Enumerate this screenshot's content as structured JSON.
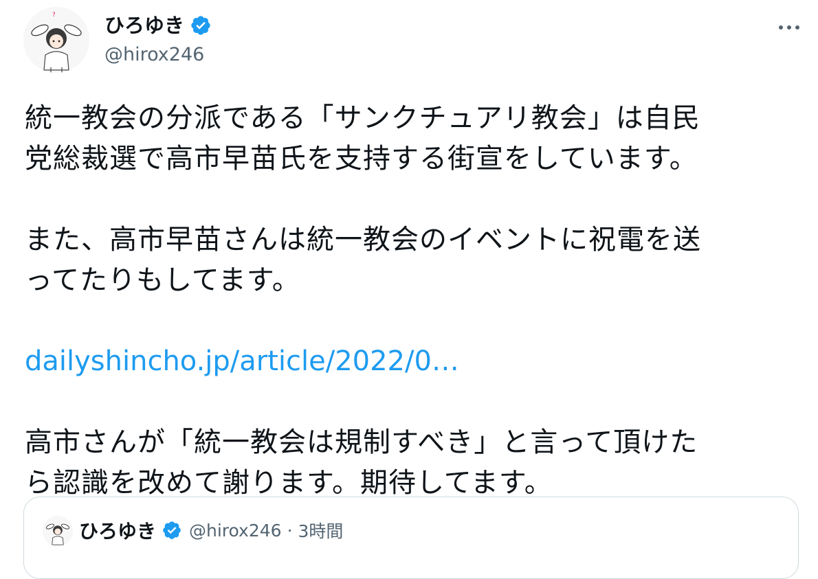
{
  "author": {
    "display_name": "ひろゆき",
    "handle": "@hirox246",
    "avatar_icon": "bunny-girl-avatar-icon",
    "verified_icon": "verified-badge-icon"
  },
  "menu": {
    "more_icon": "more-options-icon"
  },
  "tweet": {
    "para1_line1": "統一教会の分派である「サンクチュアリ教会」は自民",
    "para1_line2": "党総裁選で高市早苗氏を支持する街宣をしています。",
    "para2_line1": "また、高市早苗さんは統一教会のイベントに祝電を送",
    "para2_line2": "ってたりもしてます。",
    "link": "dailyshincho.jp/article/2022/0…",
    "para3_line1": "高市さんが「統一教会は規制すべき」と言って頂けた",
    "para3_line2": "ら認識を改めて謝ります。期待してます。"
  },
  "quote": {
    "display_name": "ひろゆき",
    "handle": "@hirox246",
    "separator": "·",
    "time": "3時間"
  },
  "colors": {
    "text": "#0f1419",
    "secondary": "#536471",
    "link": "#1d9bf0",
    "verified": "#1d9bf0",
    "border": "#cfd9de"
  }
}
